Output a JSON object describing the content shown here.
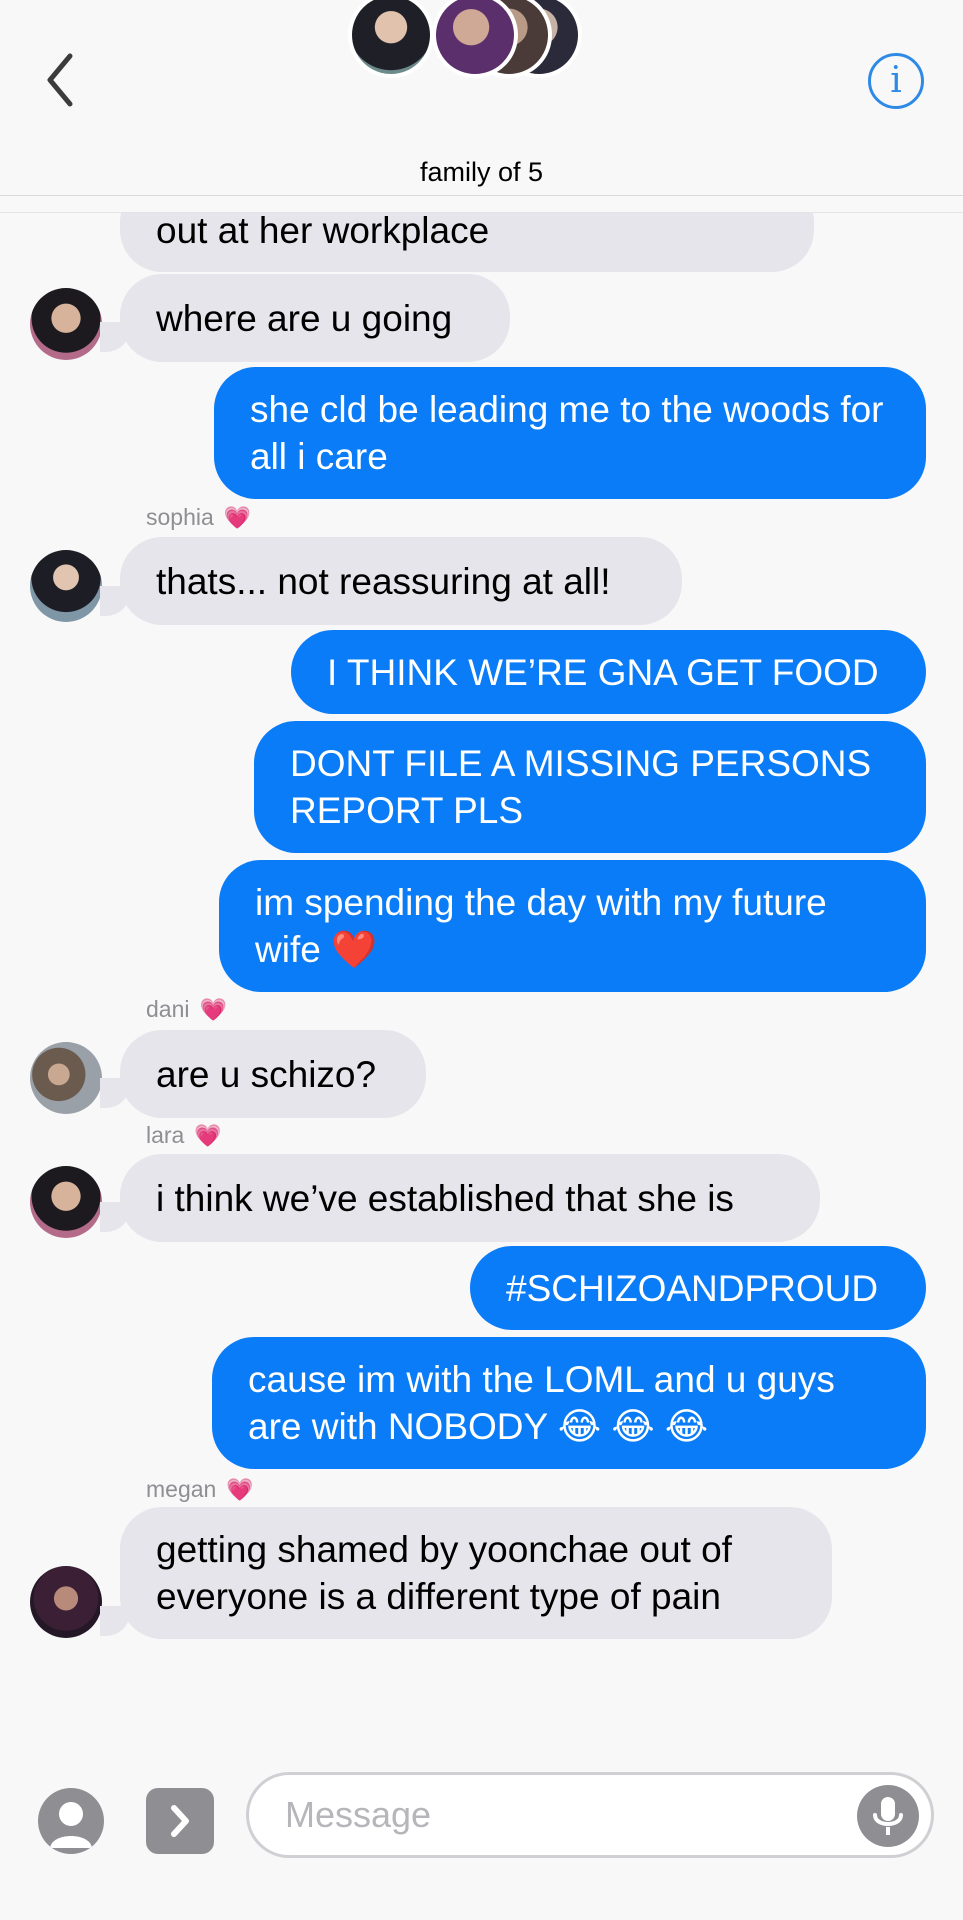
{
  "header": {
    "title": "family of 5",
    "back_icon": "chevron-left-icon",
    "info_icon": "info-icon",
    "info_glyph": "i",
    "accent_color": "#2f8ae6"
  },
  "messages": [
    {
      "dir": "in",
      "text": "out at her workplace"
    },
    {
      "dir": "in",
      "text": "where are u going"
    },
    {
      "dir": "out",
      "text": "she cld be leading me to the woods for all i care"
    },
    {
      "dir": "in",
      "sender": "sophia",
      "text": "thats... not reassuring at all!"
    },
    {
      "dir": "out",
      "text": "I THINK WE’RE GNA GET FOOD"
    },
    {
      "dir": "out",
      "text": "DONT FILE A MISSING PERSONS REPORT PLS"
    },
    {
      "dir": "out",
      "text": "im spending the day with my future wife",
      "emoji": "❤️"
    },
    {
      "dir": "in",
      "sender": "dani",
      "text": "are u schizo?"
    },
    {
      "dir": "in",
      "sender": "lara",
      "text": "i think we’ve established that she is"
    },
    {
      "dir": "out",
      "text": "#SCHIZOANDPROUD"
    },
    {
      "dir": "out",
      "text": "cause im with the LOML and u guys are with NOBODY",
      "emoji": "😂 😂 😂"
    },
    {
      "dir": "in",
      "sender": "megan",
      "text": "getting shamed by yoonchae out of everyone is a different type of pain"
    }
  ],
  "sender_heart": "💗",
  "colors": {
    "sent_bubble": "#0a7cf7",
    "received_bubble": "#e6e5eb",
    "sender_label": "#8e8e93"
  },
  "input": {
    "placeholder": "Message",
    "contact_icon": "person-icon",
    "apps_icon": "chevron-right-icon",
    "mic_icon": "microphone-icon"
  }
}
